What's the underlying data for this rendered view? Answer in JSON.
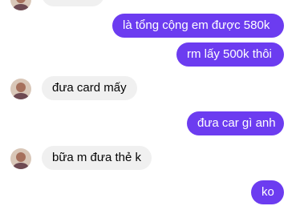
{
  "colors": {
    "outgoing_bubble": "#6c3cf0",
    "incoming_bubble": "#f0f0f0",
    "background": "#ffffff"
  },
  "messages": [
    {
      "side": "incoming",
      "text": ""
    },
    {
      "side": "outgoing",
      "text": "là tổng cộng em được 580k"
    },
    {
      "side": "outgoing",
      "text": "rm lấy 500k thôi"
    },
    {
      "side": "incoming",
      "text": "đưa card mấy"
    },
    {
      "side": "outgoing",
      "text": "đưa car gì anh"
    },
    {
      "side": "incoming",
      "text": "bữa m đưa thẻ k"
    },
    {
      "side": "outgoing",
      "text": "ko"
    }
  ]
}
